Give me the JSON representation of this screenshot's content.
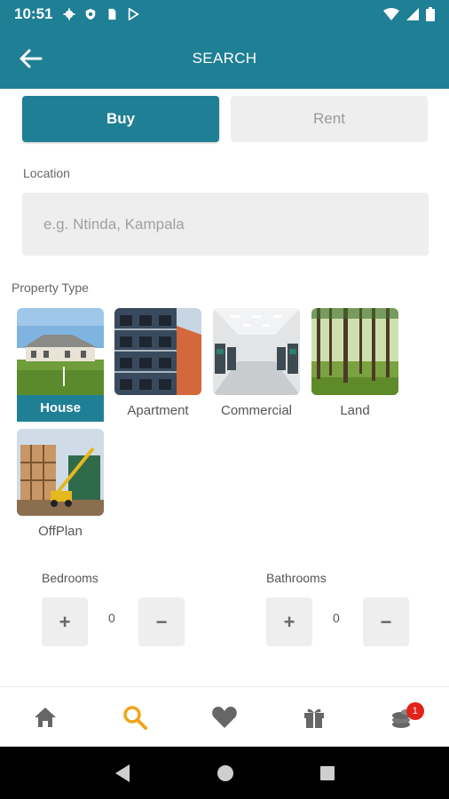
{
  "status": {
    "time": "10:51"
  },
  "header": {
    "title": "SEARCH"
  },
  "tabs": {
    "buy": "Buy",
    "rent": "Rent",
    "selected": "Buy"
  },
  "location": {
    "label": "Location",
    "placeholder": "e.g. Ntinda, Kampala",
    "value": ""
  },
  "property_type": {
    "label": "Property Type",
    "selected": "House",
    "items": [
      {
        "label": "House",
        "icon": "house-photo"
      },
      {
        "label": "Apartment",
        "icon": "apartment-photo"
      },
      {
        "label": "Commercial",
        "icon": "commercial-photo"
      },
      {
        "label": "Land",
        "icon": "land-photo"
      },
      {
        "label": "OffPlan",
        "icon": "offplan-photo"
      }
    ]
  },
  "bedrooms": {
    "label": "Bedrooms",
    "value": "0",
    "plus": "+",
    "minus": "−"
  },
  "bathrooms": {
    "label": "Bathrooms",
    "value": "0",
    "plus": "+",
    "minus": "−"
  },
  "bottom_nav": {
    "selected": "search",
    "items": [
      "home-icon",
      "search-icon",
      "heart-icon",
      "gift-icon",
      "coins-icon"
    ],
    "coins_badge": "1"
  },
  "colors": {
    "primary": "#1f7f95",
    "active_nav": "#f2a31b",
    "badge": "#e2231a"
  }
}
